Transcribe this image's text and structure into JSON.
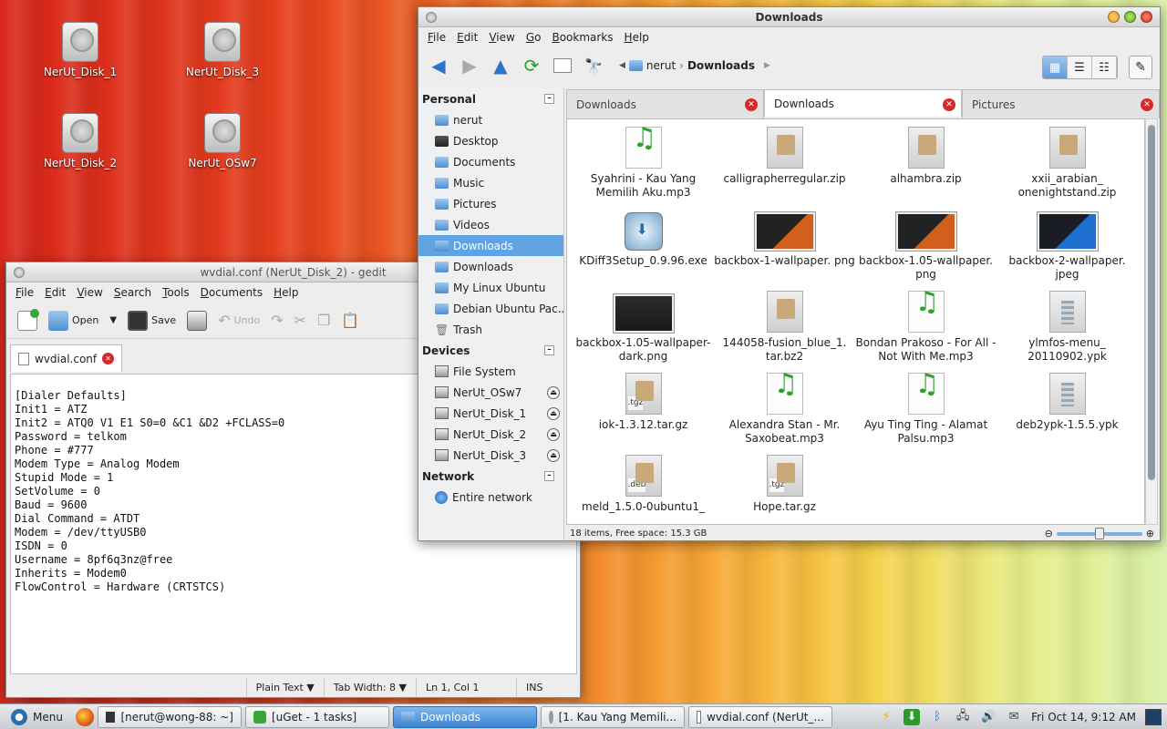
{
  "desktop": {
    "icons": [
      {
        "label": "NerUt_Disk_1"
      },
      {
        "label": "NerUt_Disk_3"
      },
      {
        "label": "NerUt_Disk_2"
      },
      {
        "label": "NerUt_OSw7"
      }
    ]
  },
  "dolphin": {
    "title": "Downloads",
    "menu": [
      "File",
      "Edit",
      "View",
      "Go",
      "Bookmarks",
      "Help"
    ],
    "breadcrumb": {
      "parent": "nerut",
      "current": "Downloads"
    },
    "places": {
      "personal_label": "Personal",
      "personal": [
        "nerut",
        "Desktop",
        "Documents",
        "Music",
        "Pictures",
        "Videos",
        "Downloads",
        "Downloads",
        "My Linux Ubuntu",
        "Debian Ubuntu Pac...",
        "Trash"
      ],
      "devices_label": "Devices",
      "devices": [
        "File System",
        "NerUt_OSw7",
        "NerUt_Disk_1",
        "NerUt_Disk_2",
        "NerUt_Disk_3"
      ],
      "network_label": "Network",
      "network": [
        "Entire network"
      ]
    },
    "tabs": [
      "Downloads",
      "Downloads",
      "Pictures"
    ],
    "files": [
      {
        "name": "Syahrini - Kau Yang Memilih Aku.mp3",
        "type": "audio"
      },
      {
        "name": "calligrapherregular.zip",
        "type": "zip"
      },
      {
        "name": "alhambra.zip",
        "type": "zip"
      },
      {
        "name": "xxii_arabian_ onenightstand.zip",
        "type": "zip"
      },
      {
        "name": "KDiff3Setup_0.9.96.exe",
        "type": "exe"
      },
      {
        "name": "backbox-1-wallpaper. png",
        "type": "img"
      },
      {
        "name": "backbox-1.05-wallpaper. png",
        "type": "img"
      },
      {
        "name": "backbox-2-wallpaper. jpeg",
        "type": "img-blue"
      },
      {
        "name": "backbox-1.05-wallpaper- dark.png",
        "type": "img-dark"
      },
      {
        "name": "144058-fusion_blue_1. tar.bz2",
        "type": "zip"
      },
      {
        "name": "Bondan Prakoso - For All - Not With Me.mp3",
        "type": "audio"
      },
      {
        "name": "ylmfos-menu_ 20110902.ypk",
        "type": "pkg"
      },
      {
        "name": "iok-1.3.12.tar.gz",
        "type": "tgz"
      },
      {
        "name": "Alexandra Stan - Mr. Saxobeat.mp3",
        "type": "audio"
      },
      {
        "name": "Ayu Ting Ting - Alamat Palsu.mp3",
        "type": "audio"
      },
      {
        "name": "deb2ypk-1.5.5.ypk",
        "type": "pkg"
      },
      {
        "name": "meld_1.5.0-0ubuntu1_",
        "type": "deb"
      },
      {
        "name": "Hope.tar.gz",
        "type": "tgz"
      }
    ],
    "status": "18 items, Free space: 15.3 GB",
    "zoom_level": 0.5
  },
  "gedit": {
    "title": "wvdial.conf (NerUt_Disk_2) - gedit",
    "menu": [
      "File",
      "Edit",
      "View",
      "Search",
      "Tools",
      "Documents",
      "Help"
    ],
    "toolbar": {
      "open": "Open",
      "save": "Save",
      "undo": "Undo"
    },
    "tab": "wvdial.conf",
    "content": "[Dialer Defaults]\nInit1 = ATZ\nInit2 = ATQ0 V1 E1 S0=0 &C1 &D2 +FCLASS=0\nPassword = telkom\nPhone = #777\nModem Type = Analog Modem\nStupid Mode = 1\nSetVolume = 0\nBaud = 9600\nDial Command = ATDT\nModem = /dev/ttyUSB0\nISDN = 0\nUsername = 8pf6q3nz@free\nInherits = Modem0\nFlowControl = Hardware (CRTSTCS)",
    "status": {
      "lang": "Plain Text ▼",
      "tabwidth": "Tab Width:  8 ▼",
      "position": "Ln 1, Col 1",
      "mode": "INS"
    }
  },
  "taskbar": {
    "menu": "Menu",
    "tasks": [
      "[nerut@wong-88: ~]",
      "[uGet - 1 tasks]",
      "Downloads",
      "[1. Kau Yang Memili...",
      "wvdial.conf (NerUt_..."
    ],
    "clock": "Fri Oct 14,  9:12 AM"
  },
  "colors": {
    "accent": "#5fa3e2",
    "close_red": "#d62a2a"
  }
}
